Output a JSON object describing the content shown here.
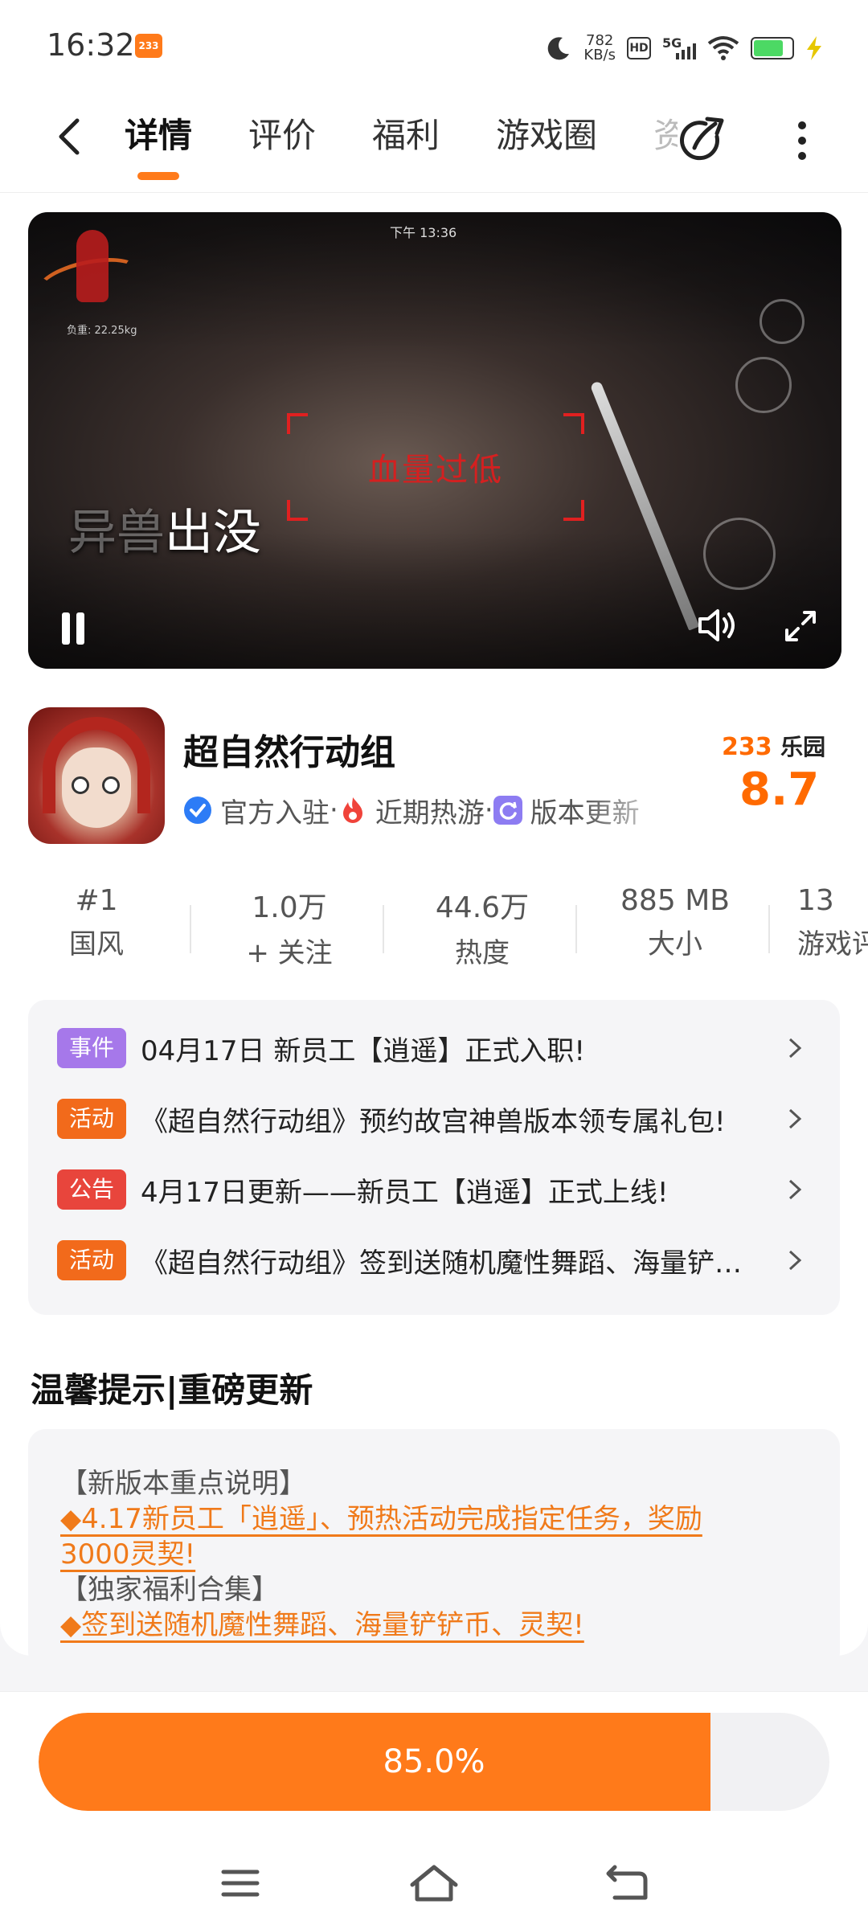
{
  "status_bar": {
    "time": "16:32",
    "app_badge": "233",
    "net_speed_value": "782",
    "net_speed_unit": "KB/s",
    "hd": "HD",
    "network": "5G"
  },
  "nav": {
    "tabs": [
      {
        "label": "详情",
        "active": true
      },
      {
        "label": "评价"
      },
      {
        "label": "福利"
      },
      {
        "label": "游戏圈"
      },
      {
        "label": "资"
      }
    ]
  },
  "video": {
    "hud_load": "负重: 22.25kg",
    "hud_time": "下午 13:36",
    "warning": "血量过低",
    "caption_dim": "异兽",
    "caption": "出没"
  },
  "game": {
    "title": "超自然行动组",
    "tags": [
      {
        "label": "官方入驻",
        "icon": "verified-icon",
        "color": "#2d7cf6"
      },
      {
        "label": "近期热游",
        "icon": "fire-icon",
        "color": "#f0433a"
      },
      {
        "label": "版本更新",
        "icon": "refresh-icon",
        "color": "#8d7cf2"
      }
    ],
    "score_brand_num": "233",
    "score_brand_text": "乐园",
    "score": "8.7"
  },
  "stats": [
    {
      "value": "#1",
      "label": "国风"
    },
    {
      "value": "1.0万",
      "label": "+ 关注"
    },
    {
      "value": "44.6万",
      "label": "热度"
    },
    {
      "value": "885 MB",
      "label": "大小"
    },
    {
      "value": "13",
      "label": "游戏评"
    }
  ],
  "events": [
    {
      "badge": "事件",
      "color": "#a678ea",
      "text": "04月17日  新员工【逍遥】正式入职!"
    },
    {
      "badge": "活动",
      "color": "#f26a1b",
      "text": "《超自然行动组》预约故宫神兽版本领专属礼包!"
    },
    {
      "badge": "公告",
      "color": "#e8453c",
      "text": "4月17日更新——新员工【逍遥】正式上线!"
    },
    {
      "badge": "活动",
      "color": "#f26a1b",
      "text": "《超自然行动组》签到送随机魔性舞蹈、海量铲铲币、灵契!"
    }
  ],
  "tips": {
    "title": "温馨提示|重磅更新",
    "lines": [
      {
        "text": "【新版本重点说明】",
        "link": false
      },
      {
        "text": "◆4.17新员工「逍遥」、预热活动完成指定任务，奖励",
        "link": true
      },
      {
        "text": "3000灵契!",
        "link": true
      },
      {
        "text": "【独家福利合集】",
        "link": false
      },
      {
        "text": "◆签到送随机魔性舞蹈、海量铲铲币、灵契!",
        "link": true
      }
    ]
  },
  "download": {
    "progress_label": "85.0%",
    "progress": 0.85
  },
  "colors": {
    "accent": "#ff7a1a"
  }
}
